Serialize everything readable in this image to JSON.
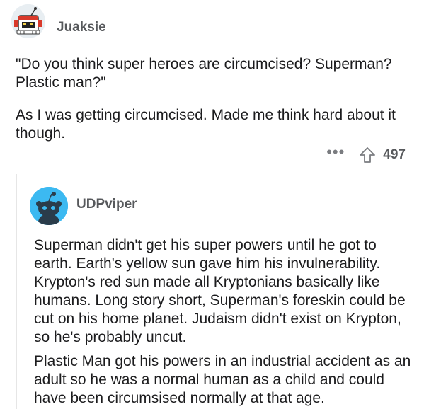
{
  "comment": {
    "username": "Juaksie",
    "paragraphs": [
      "\"Do you think super heroes are circumcised? Superman? Plastic man?\"",
      "As I was getting circumcised. Made me think hard about it though."
    ],
    "vote_count": "497",
    "icons": {
      "more": "more-options-icon",
      "upvote": "upvote-arrow-icon"
    }
  },
  "reply": {
    "username": "UDPviper",
    "paragraphs": [
      "Superman didn't get his super powers until he got to earth.  Earth's yellow sun gave him his invulnerability. Krypton's red sun made all Kryptonians basically like humans.  Long story short, Superman's foreskin could be cut on his home planet.  Judaism didn't exist on Krypton,  so he's probably uncut.",
      "Plastic Man got his powers in an industrial accident as an adult so he was a normal human as a child and could have been circumsised normally  at that age."
    ]
  },
  "colors": {
    "avatar2_bg": "#3cb9f1",
    "username": "#57595c",
    "text": "#1c1c1e",
    "thread_line": "#e6e6e6"
  }
}
